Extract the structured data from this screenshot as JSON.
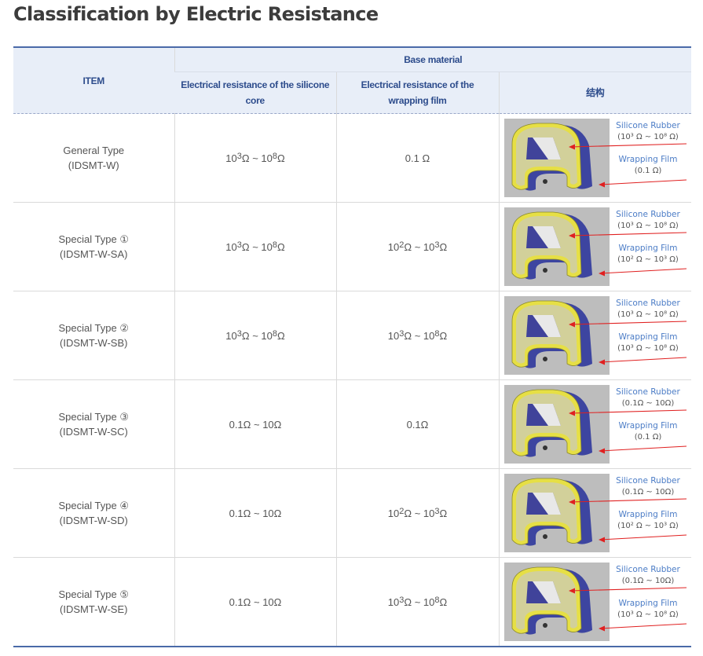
{
  "page": {
    "title": "Classification by Electric Resistance"
  },
  "table": {
    "header": {
      "item": "ITEM",
      "base_material": "Base material",
      "col_core": "Electrical resistance of the silicone core",
      "col_film": "Electrical resistance of the wrapping film",
      "col_structure": "结构"
    },
    "rows": [
      {
        "name": "General Type",
        "code": "(IDSMT-W)",
        "core": {
          "kind": "range",
          "a": "3",
          "b": "8"
        },
        "film": {
          "kind": "text",
          "text": "0.1 Ω"
        },
        "diagram": {
          "rubber_label": "Silicone  Rubber",
          "rubber_value": "(10³ Ω ~ 10⁸ Ω)",
          "film_label": "Wrapping Film",
          "film_value": "(0.1 Ω)"
        }
      },
      {
        "name": "Special Type ①",
        "code": "(IDSMT-W-SA)",
        "core": {
          "kind": "range",
          "a": "3",
          "b": "8"
        },
        "film": {
          "kind": "range",
          "a": "2",
          "b": "3"
        },
        "diagram": {
          "rubber_label": "Silicone  Rubber",
          "rubber_value": "(10³ Ω ~ 10⁸ Ω)",
          "film_label": "Wrapping Film",
          "film_value": "(10² Ω ~ 10³ Ω)"
        }
      },
      {
        "name": "Special Type ②",
        "code": "(IDSMT-W-SB)",
        "core": {
          "kind": "range",
          "a": "3",
          "b": "8"
        },
        "film": {
          "kind": "range",
          "a": "3",
          "b": "8"
        },
        "diagram": {
          "rubber_label": "Silicone  Rubber",
          "rubber_value": "(10³ Ω ~ 10⁸ Ω)",
          "film_label": "Wrapping Film",
          "film_value": "(10³ Ω ~ 10⁸ Ω)"
        }
      },
      {
        "name": "Special Type ③",
        "code": "(IDSMT-W-SC)",
        "core": {
          "kind": "text",
          "text": "0.1Ω ~ 10Ω"
        },
        "film": {
          "kind": "text",
          "text": "0.1Ω"
        },
        "diagram": {
          "rubber_label": "Silicone  Rubber",
          "rubber_value": "(0.1Ω ~ 10Ω)",
          "film_label": "Wrapping Film",
          "film_value": "(0.1 Ω)"
        }
      },
      {
        "name": "Special Type ④",
        "code": "(IDSMT-W-SD)",
        "core": {
          "kind": "text",
          "text": "0.1Ω ~ 10Ω"
        },
        "film": {
          "kind": "range",
          "a": "2",
          "b": "3"
        },
        "diagram": {
          "rubber_label": "Silicone  Rubber",
          "rubber_value": "(0.1Ω ~ 10Ω)",
          "film_label": "Wrapping Film",
          "film_value": "(10² Ω ~ 10³ Ω)"
        }
      },
      {
        "name": "Special Type ⑤",
        "code": "(IDSMT-W-SE)",
        "core": {
          "kind": "text",
          "text": "0.1Ω ~ 10Ω"
        },
        "film": {
          "kind": "range",
          "a": "3",
          "b": "8"
        },
        "diagram": {
          "rubber_label": "Silicone  Rubber",
          "rubber_value": "(0.1Ω ~ 10Ω)",
          "film_label": "Wrapping Film",
          "film_value": "(10³ Ω ~ 10⁸ Ω)"
        }
      }
    ]
  },
  "colors": {
    "header_text": "#2d4c8c",
    "header_bg": "#e8eef8",
    "rule": "#4a6aa8",
    "label_blue": "#4b7cc6",
    "film_yellow": "#e6df45",
    "arrow_red": "#e02020"
  }
}
